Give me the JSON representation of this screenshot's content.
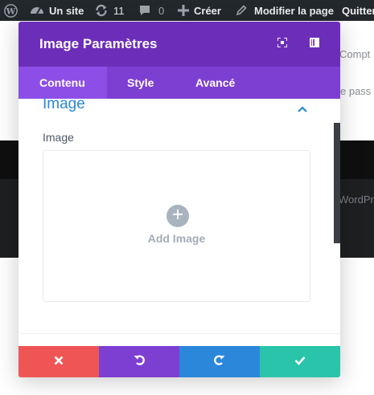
{
  "adminbar": {
    "site_label": "Un site",
    "updates_count": "11",
    "comments_count": "0",
    "create_label": "Créer",
    "edit_page_label": "Modifier la page",
    "quit_label": "Quitter"
  },
  "background": {
    "text_compte": "Compt",
    "text_passe": "e pass",
    "text_wordpress": "WordPr"
  },
  "modal": {
    "title": "Image Paramètres",
    "tabs": [
      {
        "label": "Contenu",
        "active": true
      },
      {
        "label": "Style",
        "active": false
      },
      {
        "label": "Avancé",
        "active": false
      }
    ],
    "section_title": "Image",
    "field_label": "Image",
    "add_image_label": "Add Image"
  },
  "colors": {
    "header": "#6c2eb9",
    "tabs_bar": "#7d3fd2",
    "active_tab": "#8c4ee6",
    "section_title": "#2b87da",
    "cancel": "#ef5555",
    "undo": "#7d3fd2",
    "redo": "#2b87da",
    "save": "#29c4a9"
  },
  "footer": {
    "buttons": [
      {
        "name": "discard",
        "icon": "close-icon"
      },
      {
        "name": "undo",
        "icon": "undo-icon"
      },
      {
        "name": "redo",
        "icon": "redo-icon"
      },
      {
        "name": "save",
        "icon": "check-icon"
      }
    ]
  }
}
